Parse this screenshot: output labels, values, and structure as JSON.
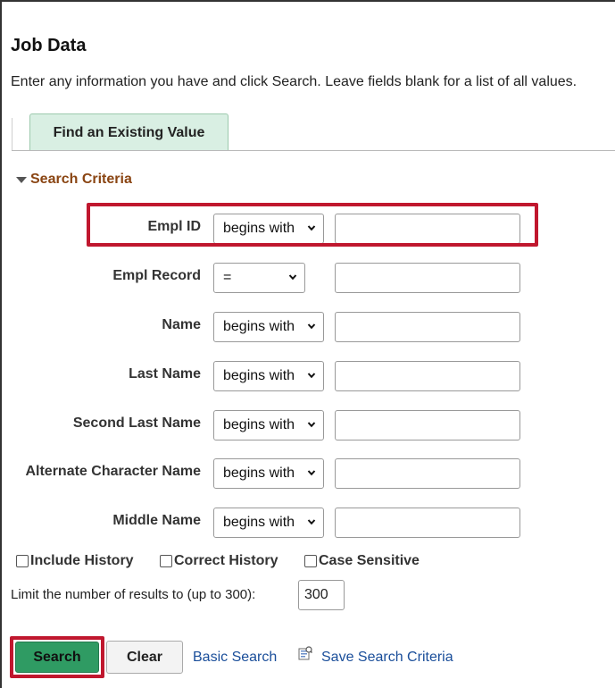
{
  "page": {
    "title": "Job Data",
    "instructions": "Enter any information you have and click Search. Leave fields blank for a list of all values."
  },
  "tabs": [
    {
      "label": "Find an Existing Value"
    }
  ],
  "criteria": {
    "header": "Search Criteria",
    "fields": [
      {
        "label": "Empl ID",
        "operator": "begins with",
        "value": ""
      },
      {
        "label": "Empl Record",
        "operator": "=",
        "value": ""
      },
      {
        "label": "Name",
        "operator": "begins with",
        "value": ""
      },
      {
        "label": "Last Name",
        "operator": "begins with",
        "value": ""
      },
      {
        "label": "Second Last Name",
        "operator": "begins with",
        "value": ""
      },
      {
        "label": "Alternate Character Name",
        "operator": "begins with",
        "value": ""
      },
      {
        "label": "Middle Name",
        "operator": "begins with",
        "value": ""
      }
    ]
  },
  "options": {
    "include_history": "Include History",
    "correct_history": "Correct History",
    "case_sensitive": "Case Sensitive"
  },
  "limit": {
    "label": "Limit the number of results to (up to 300):",
    "value": "300"
  },
  "buttons": {
    "search": "Search",
    "clear": "Clear",
    "basic_search": "Basic Search",
    "save_search_criteria": "Save Search Criteria"
  },
  "icons": {
    "expand": "triangle-down-icon",
    "select": "chevron-down-icon",
    "save": "save-search-icon"
  },
  "colors": {
    "highlight": "#c0172e",
    "search_button": "#2f9b63",
    "tab_background": "#d9efe3",
    "section_header": "#8a4513",
    "link": "#1a4e9a"
  }
}
